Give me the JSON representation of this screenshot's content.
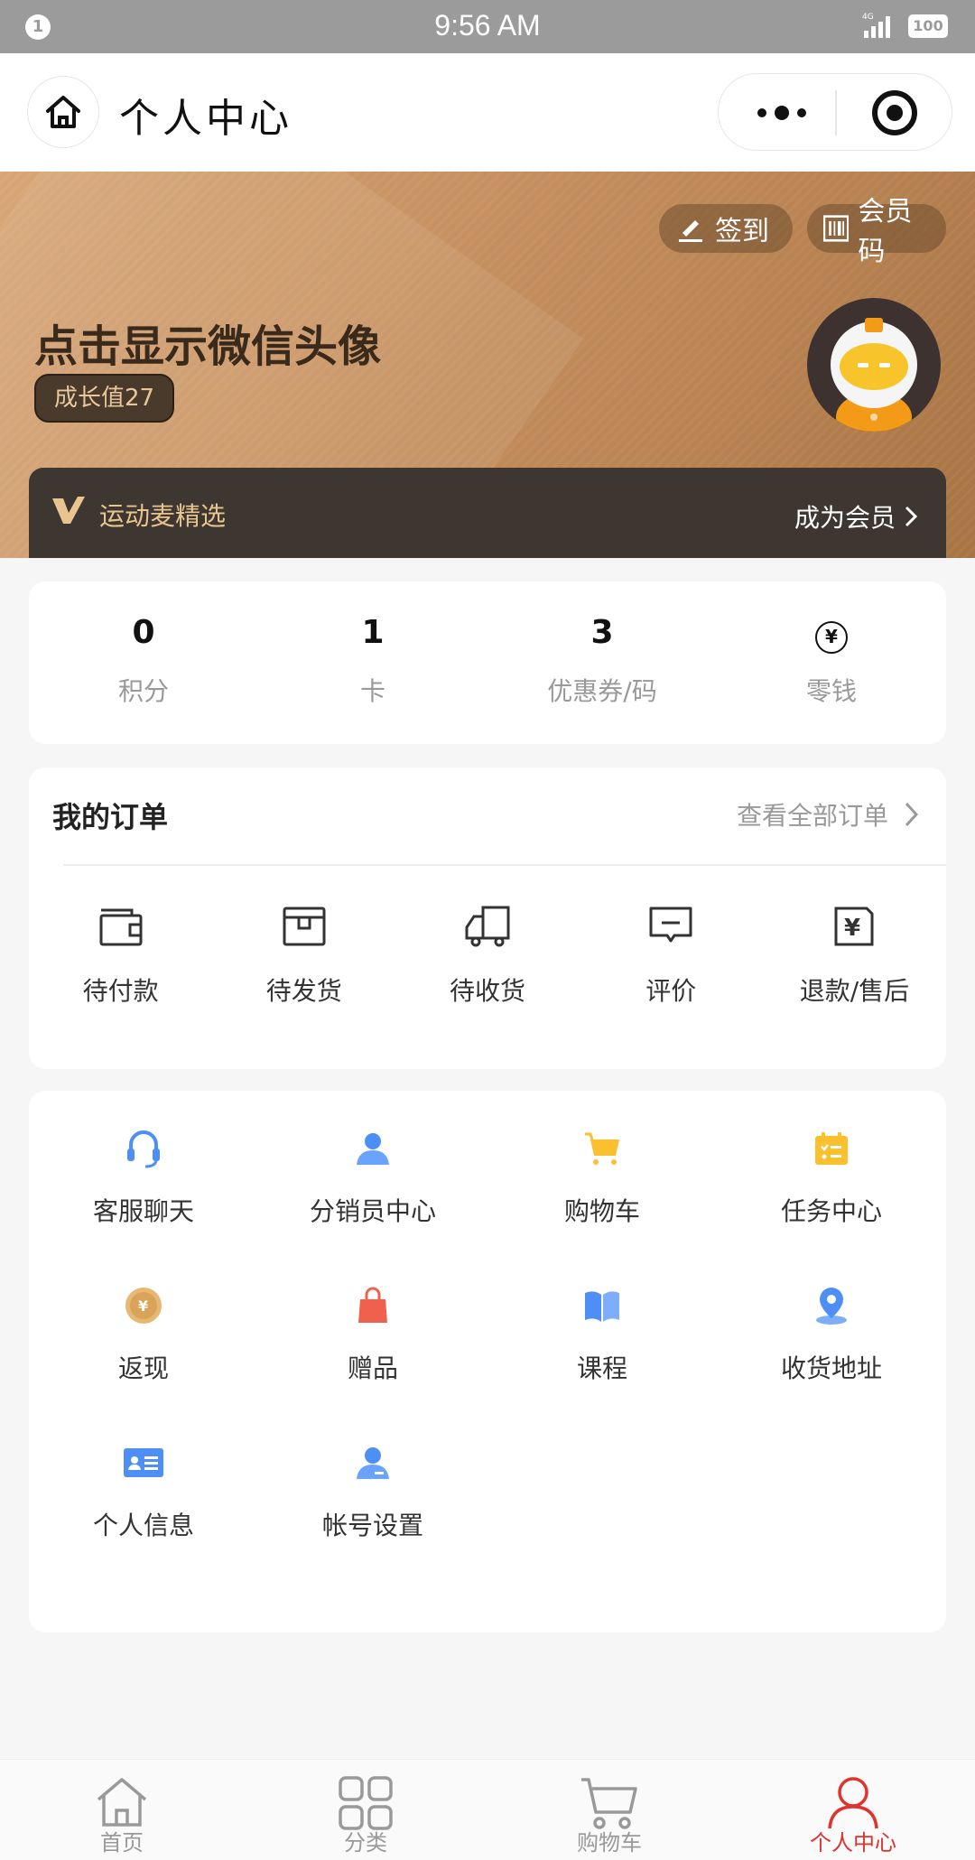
{
  "status_bar": {
    "notification_count": "1",
    "time": "9:56 AM",
    "network": "4G",
    "battery": "100"
  },
  "header": {
    "title": "个人中心"
  },
  "banner": {
    "checkin_label": "签到",
    "member_code_label": "会员码",
    "username": "点击显示微信头像",
    "growth_label": "成长值27",
    "vip": {
      "name": "运动麦精选",
      "join_label": "成为会员"
    }
  },
  "stats": [
    {
      "value": "0",
      "label": "积分"
    },
    {
      "value": "1",
      "label": "卡"
    },
    {
      "value": "3",
      "label": "优惠券/码"
    },
    {
      "value": "",
      "label": "零钱"
    }
  ],
  "orders": {
    "title": "我的订单",
    "view_all": "查看全部订单",
    "items": [
      {
        "label": "待付款",
        "icon": "wallet-icon"
      },
      {
        "label": "待发货",
        "icon": "box-icon"
      },
      {
        "label": "待收货",
        "icon": "truck-icon"
      },
      {
        "label": "评价",
        "icon": "comment-icon"
      },
      {
        "label": "退款/售后",
        "icon": "refund-icon"
      }
    ]
  },
  "services": [
    {
      "label": "客服聊天",
      "icon": "headset-icon"
    },
    {
      "label": "分销员中心",
      "icon": "user-icon"
    },
    {
      "label": "购物车",
      "icon": "cart-icon"
    },
    {
      "label": "任务中心",
      "icon": "task-icon"
    },
    {
      "label": "返现",
      "icon": "coin-icon"
    },
    {
      "label": "赠品",
      "icon": "gift-bag-icon"
    },
    {
      "label": "课程",
      "icon": "book-icon"
    },
    {
      "label": "收货地址",
      "icon": "location-icon"
    },
    {
      "label": "个人信息",
      "icon": "id-card-icon"
    },
    {
      "label": "帐号设置",
      "icon": "account-icon"
    }
  ],
  "tabbar": [
    {
      "label": "首页",
      "icon": "home-icon"
    },
    {
      "label": "分类",
      "icon": "grid-icon"
    },
    {
      "label": "购物车",
      "icon": "cart-icon"
    },
    {
      "label": "个人中心",
      "icon": "person-icon",
      "active": true
    }
  ],
  "colors": {
    "accent": "#e0332e",
    "banner_gold": "#c99463",
    "vip_text": "#e8c590",
    "icon_blue": "#4d8ff5",
    "icon_yellow": "#fbc02d",
    "icon_red": "#f0614d"
  }
}
